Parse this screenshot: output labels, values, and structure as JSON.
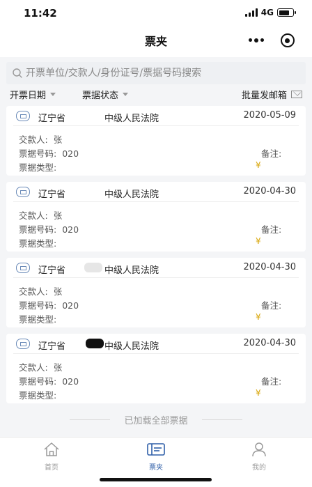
{
  "status_bar": {
    "time": "11:42",
    "network": "4G"
  },
  "nav": {
    "title": "票夹"
  },
  "search": {
    "placeholder": "开票单位/交款人/身份证号/票据号码搜索"
  },
  "filters": {
    "date_label": "开票日期",
    "status_label": "票据状态",
    "batch_mail_label": "批量发邮箱"
  },
  "cards": [
    {
      "province": "辽宁省",
      "court": "中级人民法院",
      "date": "2020-05-09",
      "payer_label": "交款人:",
      "payer_value": "张",
      "number_label": "票据号码:",
      "number_value": "020",
      "type_label": "票据类型:",
      "remark_label": "备注:",
      "currency": "¥"
    },
    {
      "province": "辽宁省",
      "court": "中级人民法院",
      "date": "2020-04-30",
      "payer_label": "交款人:",
      "payer_value": "张",
      "number_label": "票据号码:",
      "number_value": "020",
      "type_label": "票据类型:",
      "remark_label": "备注:",
      "currency": "¥"
    },
    {
      "province": "辽宁省",
      "court": "中级人民法院",
      "date": "2020-04-30",
      "payer_label": "交款人:",
      "payer_value": "张",
      "number_label": "票据号码:",
      "number_value": "020",
      "type_label": "票据类型:",
      "remark_label": "备注:",
      "currency": "¥"
    },
    {
      "province": "辽宁省",
      "court": "中级人民法院",
      "date": "2020-04-30",
      "payer_label": "交款人:",
      "payer_value": "张",
      "number_label": "票据号码:",
      "number_value": "020",
      "type_label": "票据类型:",
      "remark_label": "备注:",
      "currency": "¥"
    }
  ],
  "footer": {
    "loaded_text": "已加载全部票据"
  },
  "tabs": [
    {
      "label": "首页",
      "icon": "home-icon",
      "active": false
    },
    {
      "label": "票夹",
      "icon": "ticket-folder-icon",
      "active": true
    },
    {
      "label": "我的",
      "icon": "user-icon",
      "active": false
    }
  ],
  "colors": {
    "accent": "#2f5fa8",
    "currency": "#d7a300",
    "court_icon": "#6b8bb8"
  }
}
